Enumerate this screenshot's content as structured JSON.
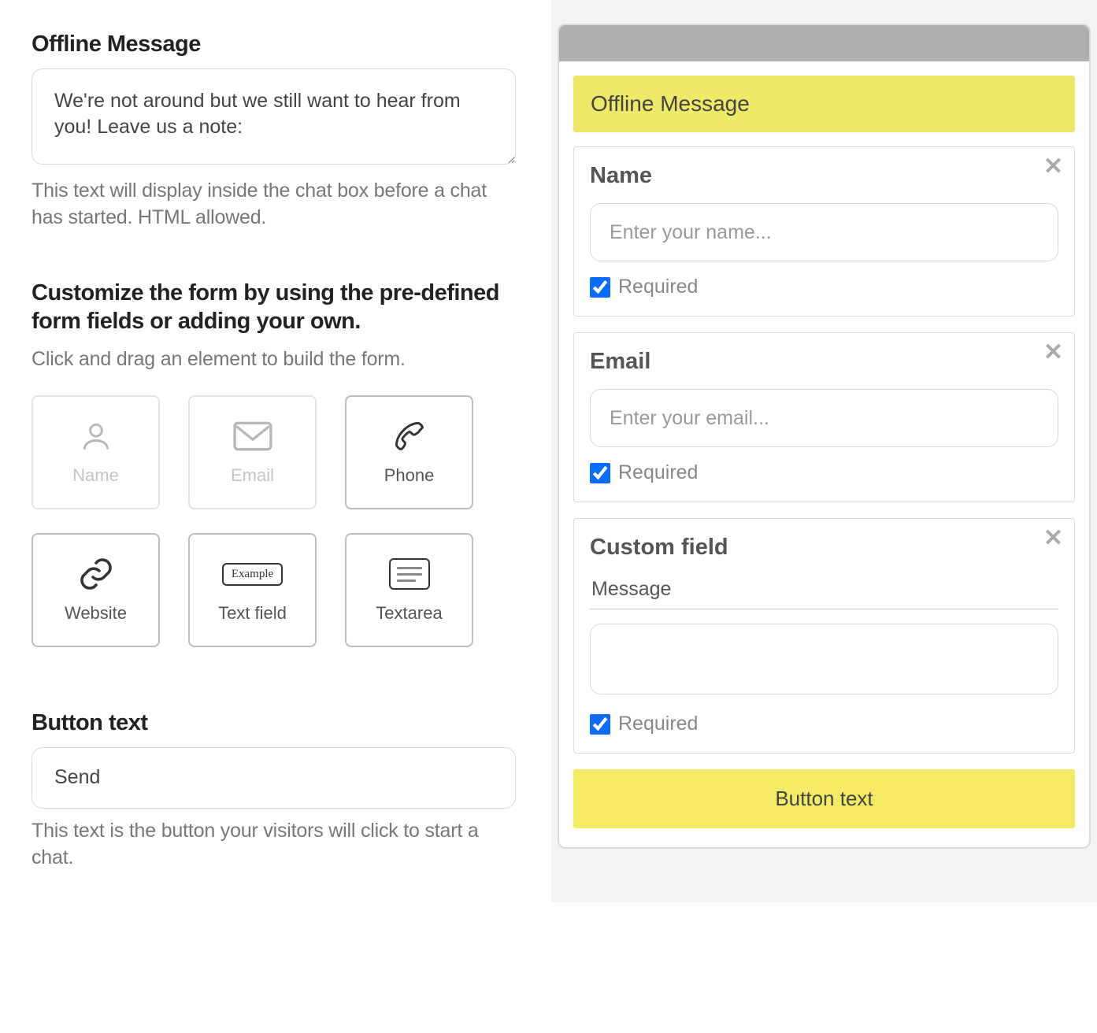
{
  "left": {
    "offline": {
      "title": "Offline Message",
      "value": "We're not around but we still want to hear from you! Leave us a note:",
      "help": "This text will display inside the chat box before a chat has started. HTML allowed."
    },
    "customize": {
      "title": "Customize the form by using the pre-defined form fields or adding your own.",
      "help": "Click and drag an element to build the form."
    },
    "tiles": [
      {
        "key": "name",
        "label": "Name",
        "disabled": true,
        "icon": "user-icon"
      },
      {
        "key": "email",
        "label": "Email",
        "disabled": true,
        "icon": "envelope-icon"
      },
      {
        "key": "phone",
        "label": "Phone",
        "disabled": false,
        "icon": "phone-icon"
      },
      {
        "key": "website",
        "label": "Website",
        "disabled": false,
        "icon": "link-icon"
      },
      {
        "key": "textfield",
        "label": "Text field",
        "disabled": false,
        "icon": "textfield-icon",
        "iconText": "Example"
      },
      {
        "key": "textarea",
        "label": "Textarea",
        "disabled": false,
        "icon": "textarea-icon"
      }
    ],
    "button": {
      "title": "Button text",
      "value": "Send",
      "help": "This text is the button your visitors will click to start a chat."
    }
  },
  "preview": {
    "banner": "Offline Message",
    "fields": [
      {
        "title": "Name",
        "placeholder": "Enter your name...",
        "required": true,
        "requiredLabel": "Required",
        "type": "text"
      },
      {
        "title": "Email",
        "placeholder": "Enter your email...",
        "required": true,
        "requiredLabel": "Required",
        "type": "text"
      },
      {
        "title": "Custom field",
        "customLabel": "Message",
        "required": true,
        "requiredLabel": "Required",
        "type": "textarea"
      }
    ],
    "cta": "Button text"
  }
}
